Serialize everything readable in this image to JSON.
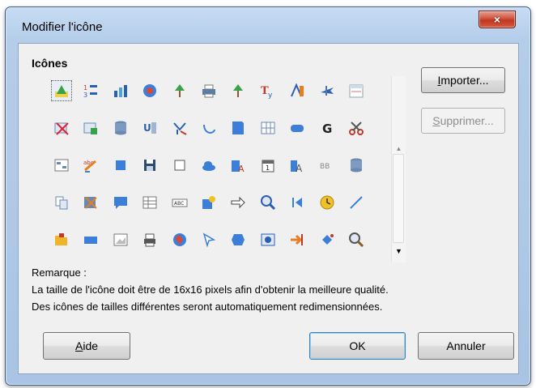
{
  "window": {
    "title": "Modifier l'icône",
    "close_label": "×"
  },
  "icons_section": {
    "label": "Icônes"
  },
  "icons": [
    [
      "wizard-icon",
      "numbering-icon",
      "stats-icon",
      "gallery-icon",
      "tree-icon",
      "printer-icon",
      "tree-icon",
      "font-format-icon",
      "text-icon",
      "airplane-icon",
      "calendar-icon"
    ],
    [
      "delete-table-icon",
      "insert-table-icon",
      "database-icon",
      "underline-icon",
      "formula-icon",
      "arc-icon",
      "note-icon",
      "grid-icon",
      "rounded-rect-icon",
      "bold-g-icon",
      "scissors-icon"
    ],
    [
      "form-icon",
      "spelling-icon",
      "square-blue-icon",
      "save-icon",
      "square-outline-icon",
      "cloud-icon",
      "text-frame-icon",
      "date-icon",
      "text-size-icon",
      "bibliography-icon",
      "database-icon"
    ],
    [
      "copy-icon",
      "cut-icon",
      "comment-icon",
      "table-icon",
      "text-field-icon",
      "gallery-paint-icon",
      "arrow-right-icon",
      "zoom-icon",
      "first-page-icon",
      "clock-icon",
      "line-icon"
    ],
    [
      "folder-open-icon",
      "rectangle-icon",
      "image-icon",
      "print-preview-icon",
      "globe-icon",
      "pointer-icon",
      "shape-icon",
      "navigator-icon",
      "arrow-in-icon",
      "paint-bucket-icon",
      "search-icon"
    ]
  ],
  "buttons": {
    "import": {
      "label": "Importer...",
      "accel": "I",
      "rest": "mporter..."
    },
    "delete": {
      "label": "Supprimer...",
      "accel": "S",
      "rest": "upprimer..."
    },
    "help": {
      "label": "Aide",
      "accel": "A",
      "rest": "ide"
    },
    "ok": {
      "label": "OK"
    },
    "cancel": {
      "label": "Annuler"
    }
  },
  "remark": {
    "heading": "Remarque :",
    "line1": "La taille de l'icône doit être de 16x16 pixels afin d'obtenir la meilleure qualité.",
    "line2": "Des icônes de tailles différentes seront automatiquement redimensionnées."
  }
}
